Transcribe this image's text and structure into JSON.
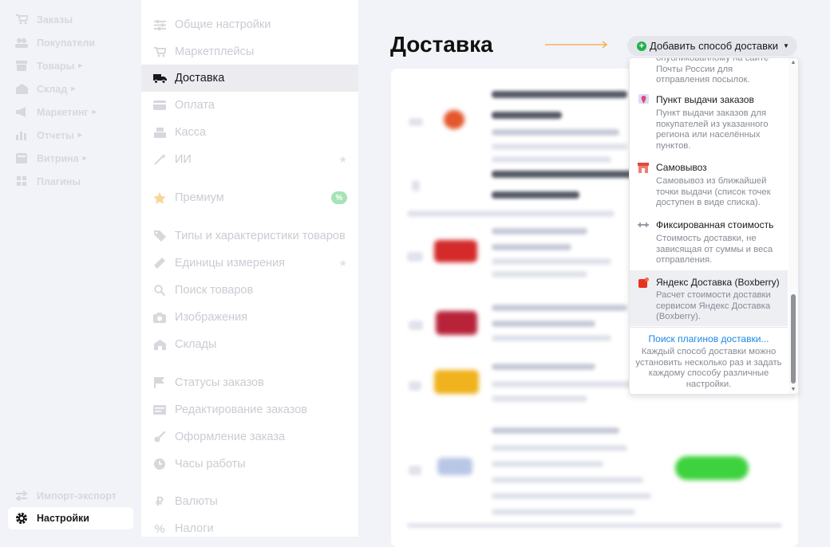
{
  "nav": {
    "items": [
      {
        "label": "Заказы",
        "icon": "cart-icon"
      },
      {
        "label": "Покупатели",
        "icon": "users-icon"
      },
      {
        "label": "Товары",
        "icon": "box-icon",
        "submenu": true
      },
      {
        "label": "Склад",
        "icon": "warehouse-icon",
        "submenu": true
      },
      {
        "label": "Маркетинг",
        "icon": "megaphone-icon",
        "submenu": true
      },
      {
        "label": "Отчеты",
        "icon": "chart-icon",
        "submenu": true
      },
      {
        "label": "Витрина",
        "icon": "storefront-icon",
        "submenu": true
      },
      {
        "label": "Плагины",
        "icon": "plugins-icon"
      }
    ],
    "bottom": [
      {
        "label": "Импорт-экспорт",
        "icon": "import-export-icon"
      },
      {
        "label": "Настройки",
        "icon": "gear-icon",
        "active": true
      }
    ]
  },
  "settings_menu": {
    "items": [
      {
        "label": "Общие настройки",
        "icon": "sliders-icon"
      },
      {
        "label": "Маркетплейсы",
        "icon": "cart-icon"
      },
      {
        "label": "Доставка",
        "icon": "truck-icon",
        "active": true
      },
      {
        "label": "Оплата",
        "icon": "credit-card-icon"
      },
      {
        "label": "Касса",
        "icon": "cash-register-icon"
      },
      {
        "label": "ИИ",
        "icon": "magic-wand-icon",
        "star": true
      },
      {
        "label": "Премиум",
        "icon": "star-icon",
        "badge": "%"
      },
      {
        "label": "Типы и характеристики товаров",
        "icon": "tags-icon"
      },
      {
        "label": "Единицы измерения",
        "icon": "ruler-icon",
        "star": true
      },
      {
        "label": "Поиск товаров",
        "icon": "search-icon"
      },
      {
        "label": "Изображения",
        "icon": "camera-icon"
      },
      {
        "label": "Склады",
        "icon": "warehouse-icon"
      },
      {
        "label": "Статусы заказов",
        "icon": "flag-icon"
      },
      {
        "label": "Редактирование заказов",
        "icon": "edit-order-icon"
      },
      {
        "label": "Оформление заказа",
        "icon": "checkout-icon"
      },
      {
        "label": "Часы работы",
        "icon": "clock-icon"
      },
      {
        "label": "Валюты",
        "icon": "ruble-icon"
      },
      {
        "label": "Налоги",
        "icon": "percent-icon"
      }
    ]
  },
  "main": {
    "title": "Доставка",
    "add_button": "Добавить способ доставки"
  },
  "dropdown": {
    "options": [
      {
        "title": "",
        "desc": "опубликованному на сайте Почты России для отправления посылок.",
        "icon": "post-icon"
      },
      {
        "title": "Пункт выдачи заказов",
        "desc": "Пункт выдачи заказов для покупателей из указанного региона или населённых пунктов.",
        "icon": "map-pin-icon"
      },
      {
        "title": "Самовывоз",
        "desc": "Самовывоз из ближайшей точки выдачи (список точек доступен в виде списка).",
        "icon": "store-icon"
      },
      {
        "title": "Фиксированная стоимость",
        "desc": "Стоимость доставки, не зависящая от суммы и веса отправления.",
        "icon": "fixed-price-icon"
      },
      {
        "title": "Яндекс Доставка (Boxberry)",
        "desc": "Расчет стоимости доставки сервисом Яндекс Доставка (Boxberry).",
        "icon": "boxberry-icon",
        "highlighted": true
      }
    ],
    "search_link": "Поиск плагинов доставки...",
    "note": "Каждый способ доставки можно установить несколько раз и задать каждому способу различные настройки."
  },
  "colors": {
    "accent_green": "#22b14c",
    "link_blue": "#1e88e5",
    "arrow_orange": "#f5b35b"
  }
}
